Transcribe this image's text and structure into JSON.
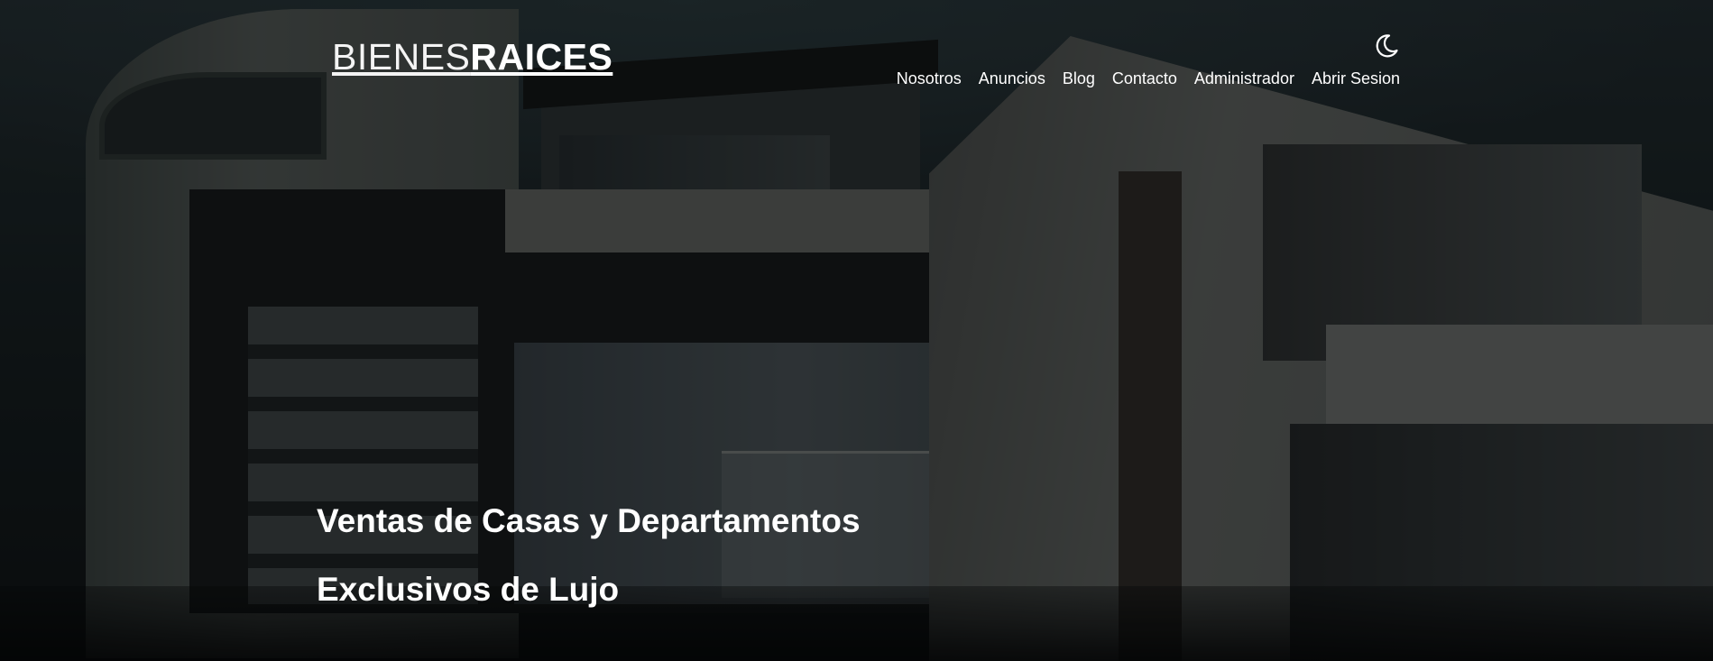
{
  "header": {
    "logo": {
      "light": "BIENES",
      "bold": "RAICES"
    },
    "theme_toggle_icon": "moon-icon",
    "nav": [
      {
        "label": "Nosotros"
      },
      {
        "label": "Anuncios"
      },
      {
        "label": "Blog"
      },
      {
        "label": "Contacto"
      },
      {
        "label": "Administrador"
      },
      {
        "label": "Abrir Sesion"
      }
    ]
  },
  "hero": {
    "title_line1": "Ventas de Casas y Departamentos",
    "title_line2": "Exclusivos de Lujo",
    "background": "modern-house-photo"
  },
  "colors": {
    "text": "#ffffff",
    "overlay": "rgba(0,0,0,0.52)"
  }
}
